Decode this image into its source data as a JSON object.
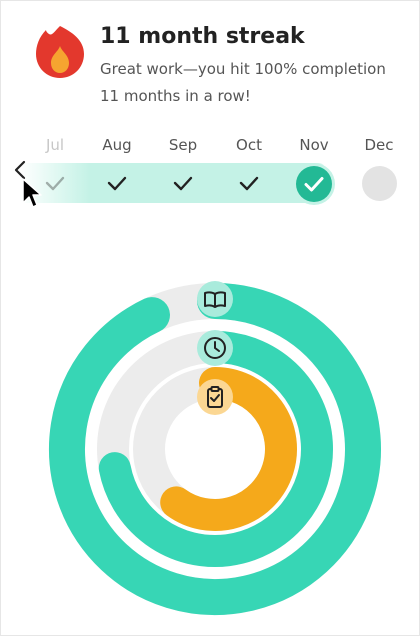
{
  "header": {
    "title": "11 month streak",
    "subtitle": "Great work—you hit 100% completion 11 months in a row!",
    "icon": "flame-icon"
  },
  "months": [
    {
      "label": "Jul",
      "status": "complete"
    },
    {
      "label": "Aug",
      "status": "complete"
    },
    {
      "label": "Sep",
      "status": "complete"
    },
    {
      "label": "Oct",
      "status": "complete"
    },
    {
      "label": "Nov",
      "status": "current-complete"
    },
    {
      "label": "Dec",
      "status": "upcoming"
    }
  ],
  "rings": [
    {
      "icon": "book-icon",
      "progress": 0.93,
      "color": "#37d6b5"
    },
    {
      "icon": "clock-icon",
      "progress": 0.72,
      "color": "#37d6b5"
    },
    {
      "icon": "clipboard-check-icon",
      "progress": 0.6,
      "color": "#f5a91b"
    }
  ],
  "colors": {
    "accent": "#23b995",
    "ring_teal": "#37d6b5",
    "ring_orange": "#f5a91b",
    "ring_track": "#ececec",
    "flame_red": "#e3382d",
    "flame_orange": "#f6a430"
  }
}
